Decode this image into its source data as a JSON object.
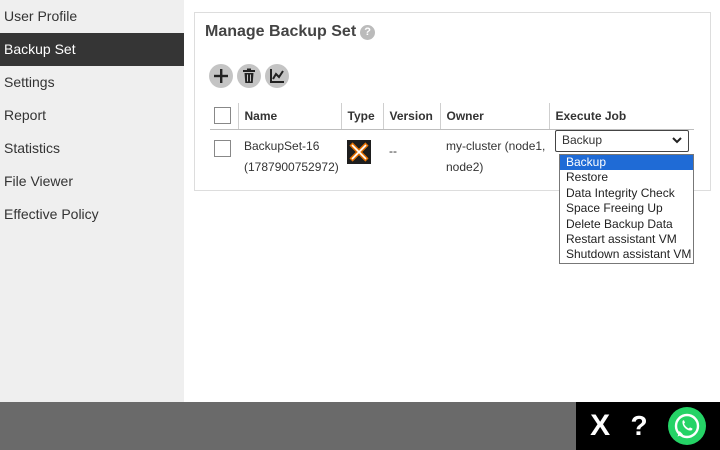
{
  "sidebar": {
    "items": [
      {
        "label": "User Profile",
        "active": false
      },
      {
        "label": "Backup Set",
        "active": true
      },
      {
        "label": "Settings",
        "active": false
      },
      {
        "label": "Report",
        "active": false
      },
      {
        "label": "Statistics",
        "active": false
      },
      {
        "label": "File Viewer",
        "active": false
      },
      {
        "label": "Effective Policy",
        "active": false
      }
    ]
  },
  "panel": {
    "title": "Manage Backup Set",
    "help_glyph": "?"
  },
  "toolbar": {
    "icons": [
      "add-icon",
      "delete-icon",
      "chart-icon"
    ]
  },
  "table": {
    "headers": {
      "name": "Name",
      "type": "Type",
      "version": "Version",
      "owner": "Owner",
      "execute": "Execute Job"
    },
    "rows": [
      {
        "name_line1": "BackupSet-16",
        "name_line2": "(1787900752972)",
        "type_icon": "proxmox-icon",
        "version": "--",
        "owner_line1": "my-cluster (node1,",
        "owner_line2": "node2)",
        "execute_selected": "Backup"
      }
    ]
  },
  "dropdown": {
    "options": [
      "Backup",
      "Restore",
      "Data Integrity Check",
      "Space Freeing Up",
      "Delete Backup Data",
      "Restart assistant VM",
      "Shutdown assistant VM"
    ],
    "selected_index": 0,
    "highlight_color": "#1f6bd6"
  },
  "bottom": {
    "close_glyph": "X",
    "help_glyph": "?",
    "whatsapp_icon": "whatsapp-icon"
  },
  "colors": {
    "sidebar_active_bg": "#353535",
    "sidebar_bg": "#efefef",
    "bottombar_bg": "#6a6a6a",
    "whatsapp_green": "#25d366"
  }
}
